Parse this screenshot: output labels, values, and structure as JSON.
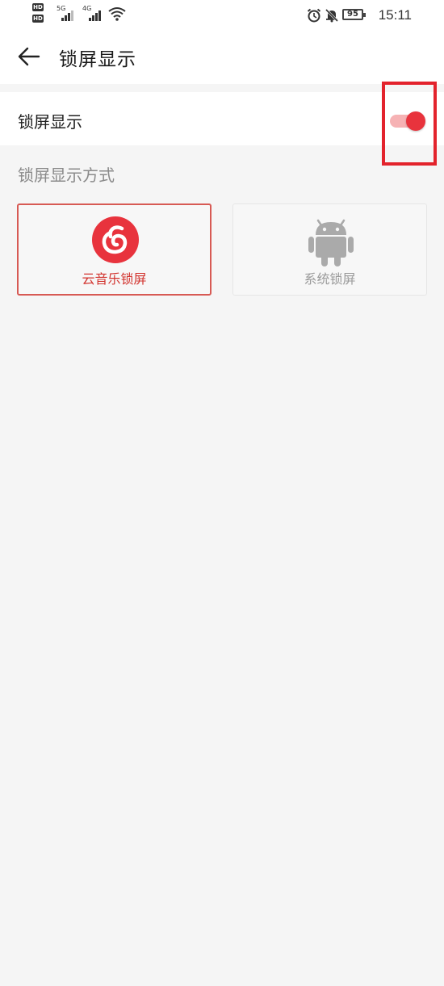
{
  "status_bar": {
    "hd_1": "HD",
    "hd_2": "HD",
    "net_1": "5G",
    "net_2": "4G",
    "battery": "95",
    "time": "15:11"
  },
  "header": {
    "title": "锁屏显示",
    "back_icon": "arrow-left-icon"
  },
  "toggle_row": {
    "label": "锁屏显示",
    "enabled": true
  },
  "section": {
    "title": "锁屏显示方式"
  },
  "options": [
    {
      "label": "云音乐锁屏",
      "icon": "netease-music-icon",
      "selected": true
    },
    {
      "label": "系统锁屏",
      "icon": "android-icon",
      "selected": false
    }
  ],
  "colors": {
    "accent": "#e8333d",
    "highlight_box": "#e3232c",
    "background": "#f5f5f5"
  }
}
